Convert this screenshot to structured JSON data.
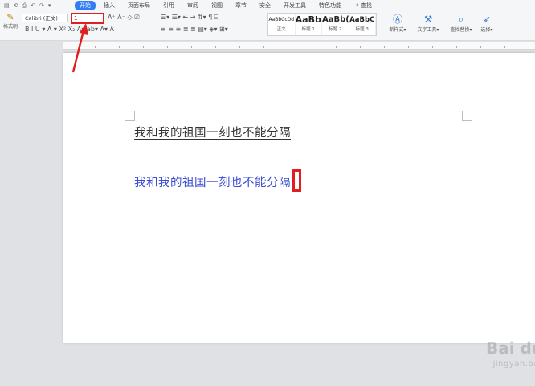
{
  "menu": {
    "quick_access": [
      "▤",
      "⟲",
      "⎙",
      "↶",
      "↷",
      "▾"
    ],
    "tabs": [
      "开始",
      "插入",
      "页面布局",
      "引用",
      "审阅",
      "视图",
      "章节",
      "安全",
      "开发工具",
      "特色功能"
    ],
    "active_tab": "开始",
    "search_label": "查找"
  },
  "toolbar": {
    "format_painter_label": "格式刷",
    "font_name": "Calibri (正文)",
    "font_size": "1",
    "row1_icons": "A⁺ A⁻ ◇ ⎚",
    "row2_icons": "B  I  U ▾  A ▾  X²  X₂  A▾  ab▾  A▾  A",
    "row3_icons": "☰▾ ☰▾ ⇤ ⇥ ⇅▾ ¶ ⌸",
    "row4_icons": "≡ ≡ ≡ ≣ ≣ ▤▾ ◈▾ ⊞▾",
    "styles": [
      {
        "sample": "AaBbCcDd",
        "name": "正文"
      },
      {
        "sample": "AaBb",
        "name": "标题 1"
      },
      {
        "sample": "AaBb(",
        "name": "标题 2"
      },
      {
        "sample": "AaBbC",
        "name": "标题 3"
      }
    ],
    "new_style_label": "新样式▾",
    "text_tools_label": "文字工具▾",
    "find_replace_label": "查找替换▾",
    "select_label": "选择▾"
  },
  "document": {
    "line1": "我和我的祖国一刻也不能分隔",
    "line2": "我和我的祖国一刻也不能分隔"
  },
  "watermark": {
    "main": "Bai du 经验",
    "sub": "jingyan.baidu.com"
  }
}
